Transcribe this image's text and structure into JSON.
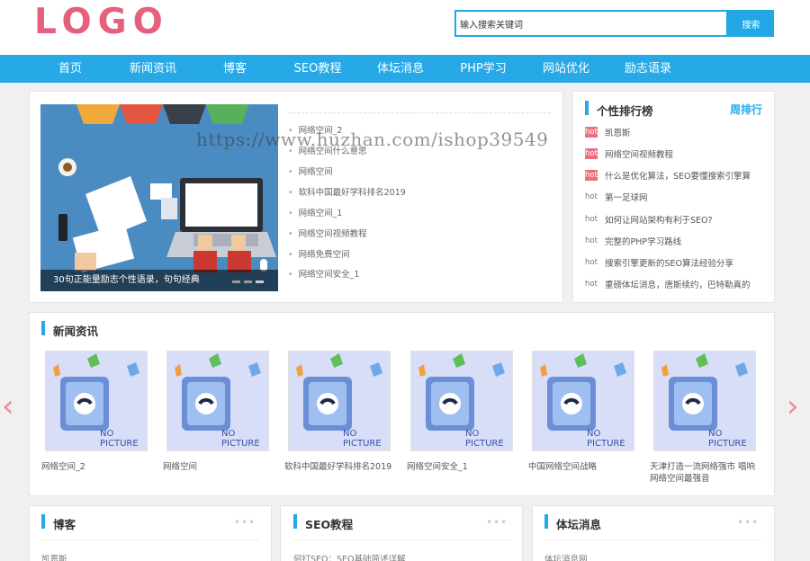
{
  "header": {
    "logo": "LOGO",
    "search_value": "输入搜索关键词",
    "search_button": "搜索"
  },
  "nav": [
    "首页",
    "新闻资讯",
    "博客",
    "SEO教程",
    "体坛消息",
    "PHP学习",
    "网站优化",
    "励志语录"
  ],
  "slider": {
    "caption": "30句正能量励志个性语录，句句经典"
  },
  "watermark": "https://www.huzhan.com/ishop39549",
  "articles": [
    "网络空间_2",
    "网络空间什么意思",
    "网络空间",
    "软科中国最好学科排名2019",
    "网络空间_1",
    "网络空间视频教程",
    "网络免费空间",
    "网络空间安全_1"
  ],
  "rank": {
    "title": "个性排行榜",
    "more": "周排行",
    "items": [
      {
        "tag": "hot",
        "text": "凯恩斯"
      },
      {
        "tag": "hot",
        "text": "网络空间视频教程"
      },
      {
        "tag": "hot",
        "text": "什么是优化算法，SEO要懂搜索引擎算"
      },
      {
        "tag": "hot",
        "text": "第一足球网"
      },
      {
        "tag": "hot",
        "text": "如何让网站架构有利于SEO?"
      },
      {
        "tag": "hot",
        "text": "完整的PHP学习路线"
      },
      {
        "tag": "hot",
        "text": "搜索引擎更新的SEO算法经验分享"
      },
      {
        "tag": "hot",
        "text": "重磅体坛消息，唐斯续约，巴特勒真的"
      }
    ]
  },
  "news": {
    "title": "新闻资讯",
    "placeholder": "NO PICTURE",
    "items": [
      {
        "cap1": "网络空间_2",
        "cap2": ""
      },
      {
        "cap1": "网络空间",
        "cap2": ""
      },
      {
        "cap1": "软科中国最好学科排名2019",
        "cap2": ""
      },
      {
        "cap1": "网络空间安全_1",
        "cap2": ""
      },
      {
        "cap1": "中国网络空间战略",
        "cap2": ""
      },
      {
        "cap1": "天津打造一流网络强市 唱响",
        "cap2": "网络空间最强音"
      }
    ]
  },
  "columns": [
    {
      "title": "博客",
      "more": "•••",
      "first": "凯恩斯"
    },
    {
      "title": "SEO教程",
      "more": "•••",
      "first": "何打SEO：SEO基础简述详解"
    },
    {
      "title": "体坛消息",
      "more": "•••",
      "first": "体坛消息网"
    }
  ],
  "colors": {
    "accent": "#27a9e8",
    "logo": "#e4607c",
    "hot": "#e96f7e"
  }
}
